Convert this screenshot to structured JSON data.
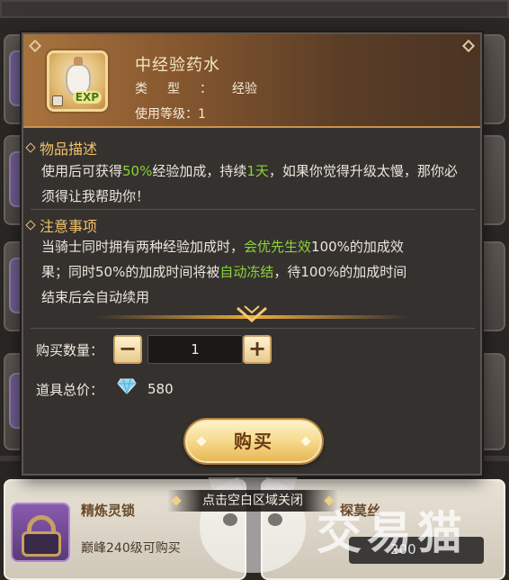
{
  "popup": {
    "item_title": "中经验药水",
    "type_label": "类型：",
    "type_value": "经验",
    "level_label": "使用等级：",
    "level_value": "1",
    "icon_badge": "EXP",
    "description": {
      "title": "物品描述",
      "text_1": "使用后可获得",
      "hl_1": "50%",
      "text_2": "经验加成，持续",
      "hl_2": "1天",
      "text_3": "，如果你觉得升级太慢，那你必须得让我帮助你！"
    },
    "notes": {
      "title": "注意事项",
      "text_1": "当骑士同时拥有两种经验加成时，",
      "hl_1": "会优先生效",
      "text_2": "100%的加成效果；同时50%的加成时间将被",
      "hl_2": "自动冻结",
      "text_3": "，待100%的加成时间结束后会自动续用"
    },
    "quantity": {
      "label": "购买数量：",
      "minus": "−",
      "value": "1",
      "plus": "+"
    },
    "total": {
      "label": "道具总价：",
      "currency_icon": "diamond-icon",
      "value": "580"
    },
    "buy_label": "购买"
  },
  "close_hint": "点击空白区域关闭",
  "background": {
    "item_name": "精炼灵锁",
    "item_requirement": "巅峰240级可购买",
    "right_item_name": "探莫丝",
    "right_price": "200"
  },
  "watermark": "交易猫",
  "colors": {
    "highlight_green": "#8bd23a",
    "section_gold": "#f2c26a",
    "header_brown": "#a8733e"
  }
}
